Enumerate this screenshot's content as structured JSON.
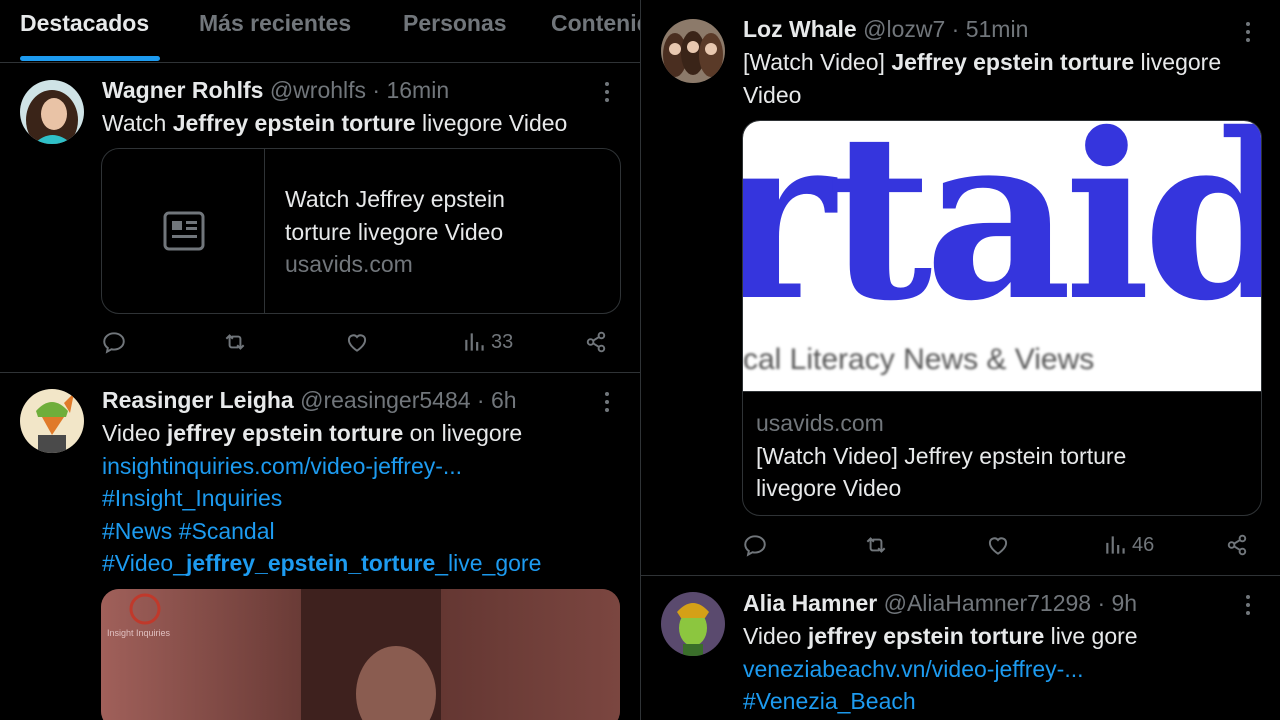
{
  "colors": {
    "background": "#000000",
    "text": "#e7e9ea",
    "muted": "#71767b",
    "accent": "#1d9bf0",
    "border": "#2f3336"
  },
  "tabs": [
    {
      "label": "Destacados",
      "active": true
    },
    {
      "label": "Más recientes",
      "active": false
    },
    {
      "label": "Personas",
      "active": false
    },
    {
      "label": "Contenido",
      "active": false
    }
  ],
  "posts": [
    {
      "name": "Wagner Rohlfs",
      "handle": "@wrohlfs",
      "time": "· 16min",
      "text": {
        "pre": "Watch ",
        "bold": "Jeffrey epstein torture",
        "post": " livegore Video"
      },
      "card": {
        "title_line1": "Watch Jeffrey epstein",
        "title_line2": "torture livegore Video",
        "domain": "usavids.com",
        "icon": "article-icon"
      },
      "views": "33"
    },
    {
      "name": "Reasinger Leigha",
      "handle": "@reasinger5484",
      "time": "· 6h",
      "text": {
        "pre": "Video ",
        "bold": "jeffrey epstein torture",
        "post": " on livegore"
      },
      "link": "insightinquiries.com/video-jeffrey-...",
      "hashtag1": "#Insight_Inquiries",
      "hashtag2": "#News #Scandal",
      "hashtag3": {
        "pre": "#Video_",
        "bold": "jeffrey_epstein_torture",
        "post": "_live_gore"
      },
      "media_watermark": "Insight Inquiries"
    },
    {
      "name": "Loz Whale",
      "handle": "@lozw7",
      "time": "· 51min",
      "text": {
        "pre": "[Watch Video] ",
        "bold": "Jeffrey epstein torture",
        "post": " livegore",
        "line2": "Video"
      },
      "media_text": "rtaid",
      "media_subtext": "cal Literacy News & Views",
      "card": {
        "domain": "usavids.com",
        "title_line1": "[Watch Video] Jeffrey epstein torture",
        "title_line2": "livegore Video"
      },
      "views": "46"
    },
    {
      "name": "Alia Hamner",
      "handle": "@AliaHamner71298",
      "time": "· 9h",
      "text": {
        "pre": "Video ",
        "bold": "jeffrey epstein torture",
        "post": " live gore"
      },
      "link": "veneziabeachv.vn/video-jeffrey-...",
      "hashtag1": "#Venezia_Beach"
    }
  ]
}
